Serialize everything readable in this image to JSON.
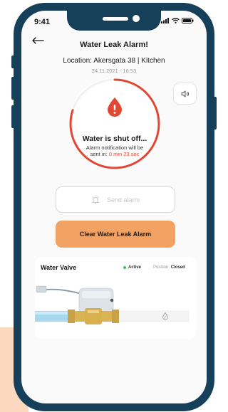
{
  "status_bar": {
    "time": "9:41"
  },
  "header": {
    "title": "Water Leak Alarm!",
    "location": "Location: Akersgata 38 | Kitchen",
    "timestamp": "24.11.2021 - 16:53"
  },
  "alarm": {
    "headline": "Water is shut off...",
    "notice_line1": "Alarm notification will be",
    "notice_prefix": "sent in:",
    "countdown": "0 min 23 sec",
    "countdown_progress": 0.8
  },
  "actions": {
    "send_label": "Send alarm",
    "clear_label": "Clear Water Leak Alarm"
  },
  "valve": {
    "title": "Water Valve",
    "state": "Active",
    "position_label": "Position:",
    "position_value": "Closed"
  },
  "colors": {
    "brand_dark": "#16405a",
    "accent_orange": "#f2a263",
    "alert_red": "#e24733",
    "status_green": "#3cc05b"
  },
  "icons": {
    "back": "arrow-left-icon",
    "sound": "speaker-icon",
    "alert": "water-drop-alert-icon",
    "send": "bell-icon",
    "water": "water-drop-icon"
  }
}
